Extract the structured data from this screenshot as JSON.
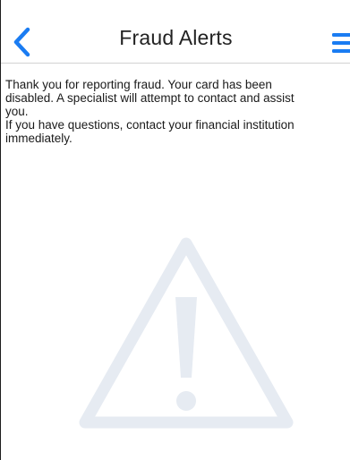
{
  "header": {
    "title": "Fraud Alerts",
    "back_icon": "chevron-left-icon",
    "menu_icon": "hamburger-menu-icon"
  },
  "message": {
    "lines": [
      "Thank you for reporting fraud. Your card has been",
      "disabled. A specialist will attempt to contact and assist",
      "you.",
      "If you have questions, contact your financial institution",
      "immediately."
    ]
  },
  "watermark": {
    "icon": "warning-triangle-icon"
  },
  "colors": {
    "accent": "#1a7cf2",
    "text": "#1a1a1a",
    "title_text": "#222222",
    "divider": "#d2d2d2",
    "watermark": "#e6ebf2"
  }
}
